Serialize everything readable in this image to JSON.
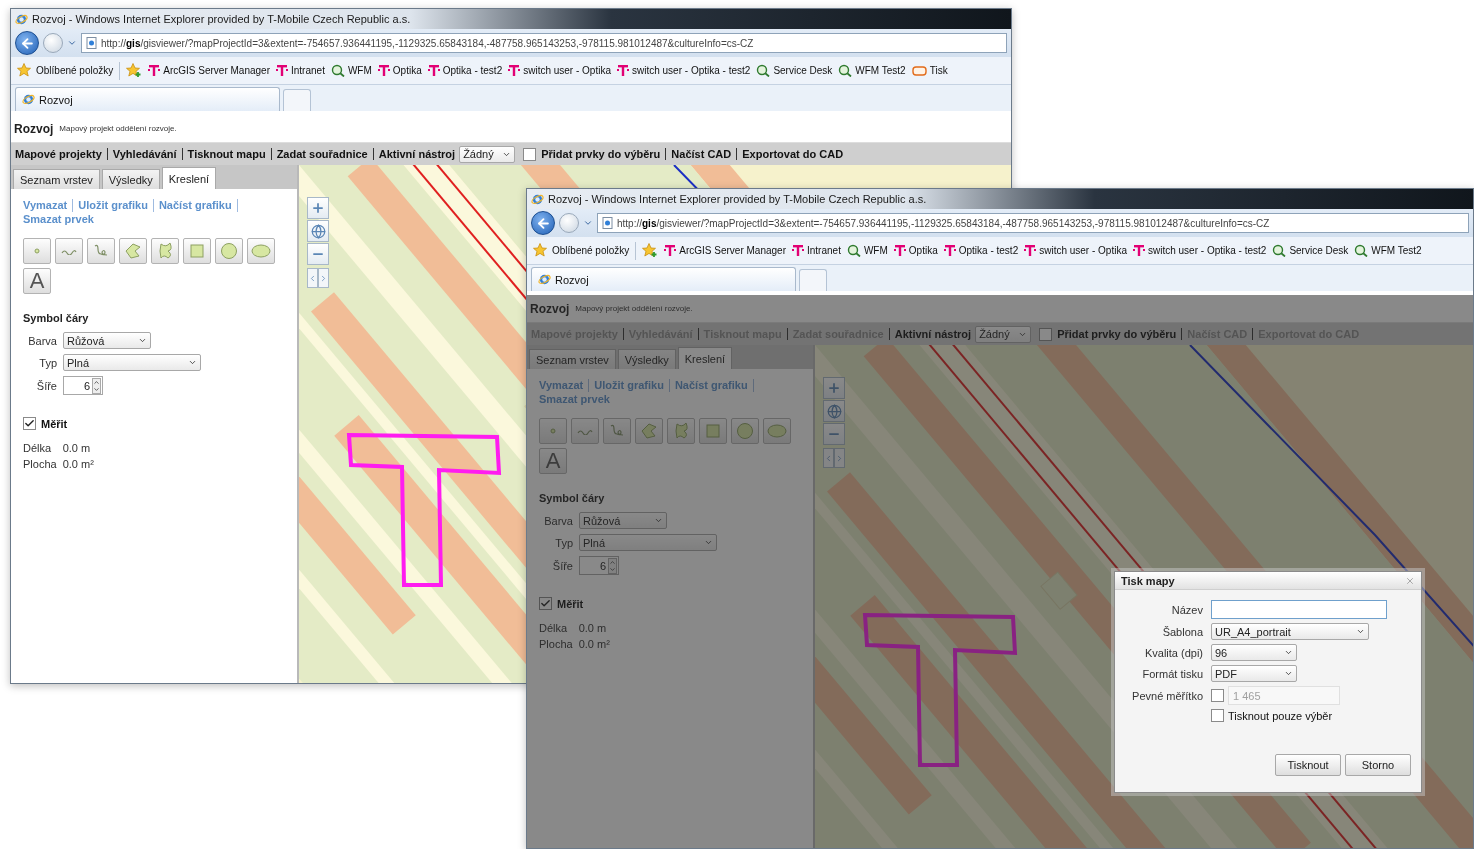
{
  "windows": [
    {
      "title": "Rozvoj - Windows Internet Explorer provided by T-Mobile Czech Republic a.s.",
      "url": "http://**gis**/gisviewer/?mapProjectId=3&extent=-754657.936441195,-1129325.65843184,-487758.965143253,-978115.981012487&cultureInfo=cs-CZ",
      "favorites_label": "Oblíbené položky",
      "bookmarks": [
        {
          "label": "ArcGIS Server Manager",
          "kind": "tmobile"
        },
        {
          "label": "Intranet",
          "kind": "tmobile"
        },
        {
          "label": "WFM",
          "kind": "wfm"
        },
        {
          "label": "Optika",
          "kind": "tmobile"
        },
        {
          "label": "Optika - test2",
          "kind": "tmobile"
        },
        {
          "label": "switch user - Optika",
          "kind": "tmobile"
        },
        {
          "label": "switch user - Optika - test2",
          "kind": "tmobile"
        },
        {
          "label": "Service Desk",
          "kind": "wfm"
        },
        {
          "label": "WFM Test2",
          "kind": "wfm"
        },
        {
          "label": "Tisk",
          "kind": "print"
        }
      ],
      "tabs": [
        {
          "label": "Rozvoj",
          "selected": true
        }
      ],
      "app": {
        "title": "Rozvoj",
        "subtitle": "Mapový projekt oddělení rozvoje.",
        "toolbar": [
          {
            "kind": "link",
            "text": "Mapové projekty",
            "disabled": false
          },
          {
            "kind": "link",
            "text": "Vyhledávání",
            "disabled": false
          },
          {
            "kind": "link",
            "text": "Tisknout mapu",
            "disabled": false
          },
          {
            "kind": "link",
            "text": "Zadat souřadnice",
            "disabled": false
          },
          {
            "kind": "label",
            "text": "Aktivní nástroj"
          },
          {
            "kind": "select",
            "text": "Žádný"
          },
          {
            "kind": "checkbox",
            "text": "Přidat prvky do výběru",
            "checked": false
          },
          {
            "kind": "link",
            "text": "Načíst CAD",
            "disabled": false
          },
          {
            "kind": "link",
            "text": "Exportovat do CAD",
            "disabled": false
          }
        ],
        "panel": {
          "tabs": [
            {
              "label": "Seznam vrstev",
              "selected": false
            },
            {
              "label": "Výsledky",
              "selected": false
            },
            {
              "label": "Kreslení",
              "selected": true
            }
          ],
          "links": [
            "Vymazat",
            "Uložit grafiku",
            "Načíst grafiku",
            "Smazat prvek"
          ],
          "tools": [
            {
              "kind": "point"
            },
            {
              "kind": "polyline"
            },
            {
              "kind": "freehand"
            },
            {
              "kind": "polygon"
            },
            {
              "kind": "freehand_polygon"
            },
            {
              "kind": "rectangle"
            },
            {
              "kind": "circle"
            },
            {
              "kind": "ellipse"
            },
            {
              "kind": "text",
              "label": "A"
            }
          ],
          "section_title": "Symbol čáry",
          "fields": [
            {
              "label": "Barva",
              "kind": "select",
              "value": "Růžová"
            },
            {
              "label": "Typ",
              "kind": "select",
              "value": "Plná"
            },
            {
              "label": "Šíře",
              "kind": "spinner",
              "value": "6"
            }
          ],
          "measure": {
            "label": "Měřit",
            "checked": true
          },
          "readouts": [
            {
              "label": "Délka",
              "value": "0.0 m"
            },
            {
              "label": "Plocha",
              "value": "0.0 m²"
            }
          ]
        }
      },
      "modal_open": false
    },
    {
      "title": "Rozvoj - Windows Internet Explorer provided by T-Mobile Czech Republic a.s.",
      "url": "http://**gis**/gisviewer/?mapProjectId=3&extent=-754657.936441195,-1129325.65843184,-487758.965143253,-978115.981012487&cultureInfo=cs-CZ",
      "favorites_label": "Oblíbené položky",
      "bookmarks": [
        {
          "label": "ArcGIS Server Manager",
          "kind": "tmobile"
        },
        {
          "label": "Intranet",
          "kind": "tmobile"
        },
        {
          "label": "WFM",
          "kind": "wfm"
        },
        {
          "label": "Optika",
          "kind": "tmobile"
        },
        {
          "label": "Optika - test2",
          "kind": "tmobile"
        },
        {
          "label": "switch user - Optika",
          "kind": "tmobile"
        },
        {
          "label": "switch user - Optika - test2",
          "kind": "tmobile"
        },
        {
          "label": "Service Desk",
          "kind": "wfm"
        },
        {
          "label": "WFM Test2",
          "kind": "wfm"
        }
      ],
      "tabs": [
        {
          "label": "Rozvoj",
          "selected": true
        }
      ],
      "app": {
        "title": "Rozvoj",
        "subtitle": "Mapový projekt oddělení rozvoje.",
        "toolbar": [
          {
            "kind": "link",
            "text": "Mapové projekty",
            "disabled": true
          },
          {
            "kind": "link",
            "text": "Vyhledávání",
            "disabled": true
          },
          {
            "kind": "link",
            "text": "Tisknout mapu",
            "disabled": true
          },
          {
            "kind": "link",
            "text": "Zadat souřadnice",
            "disabled": true
          },
          {
            "kind": "label",
            "text": "Aktivní nástroj"
          },
          {
            "kind": "select",
            "text": "Žádný"
          },
          {
            "kind": "checkbox",
            "text": "Přidat prvky do výběru",
            "checked": false
          },
          {
            "kind": "link",
            "text": "Načíst CAD",
            "disabled": true
          },
          {
            "kind": "link",
            "text": "Exportovat do CAD",
            "disabled": true
          }
        ],
        "panel": {
          "tabs": [
            {
              "label": "Seznam vrstev",
              "selected": false
            },
            {
              "label": "Výsledky",
              "selected": false
            },
            {
              "label": "Kreslení",
              "selected": true
            }
          ],
          "links": [
            "Vymazat",
            "Uložit grafiku",
            "Načíst grafiku",
            "Smazat prvek"
          ],
          "tools": [
            {
              "kind": "point"
            },
            {
              "kind": "polyline"
            },
            {
              "kind": "freehand"
            },
            {
              "kind": "polygon"
            },
            {
              "kind": "freehand_polygon"
            },
            {
              "kind": "rectangle"
            },
            {
              "kind": "circle"
            },
            {
              "kind": "ellipse"
            },
            {
              "kind": "text",
              "label": "A"
            }
          ],
          "section_title": "Symbol čáry",
          "fields": [
            {
              "label": "Barva",
              "kind": "select",
              "value": "Růžová"
            },
            {
              "label": "Typ",
              "kind": "select",
              "value": "Plná"
            },
            {
              "label": "Šíře",
              "kind": "spinner",
              "value": "6"
            }
          ],
          "measure": {
            "label": "Měřit",
            "checked": true
          },
          "readouts": [
            {
              "label": "Délka",
              "value": "0.0 m"
            },
            {
              "label": "Plocha",
              "value": "0.0 m²"
            }
          ]
        }
      },
      "modal_open": true,
      "dialog": {
        "title": "Tisk mapy",
        "fields": [
          {
            "label": "Název",
            "kind": "text"
          },
          {
            "label": "Šablona",
            "kind": "select",
            "value": "UR_A4_portrait"
          },
          {
            "label": "Kvalita (dpi)",
            "kind": "select",
            "value": "96"
          },
          {
            "label": "Formát tisku",
            "kind": "select",
            "value": "PDF"
          },
          {
            "label": "Pevné měřítko",
            "kind": "checkbox_input",
            "checked": false,
            "value": "1 465",
            "disabled": true
          },
          {
            "label": "Tisknout pouze výběr",
            "kind": "checkbox",
            "checked": false
          }
        ],
        "buttons": [
          "Tisknout",
          "Storno"
        ]
      }
    }
  ]
}
